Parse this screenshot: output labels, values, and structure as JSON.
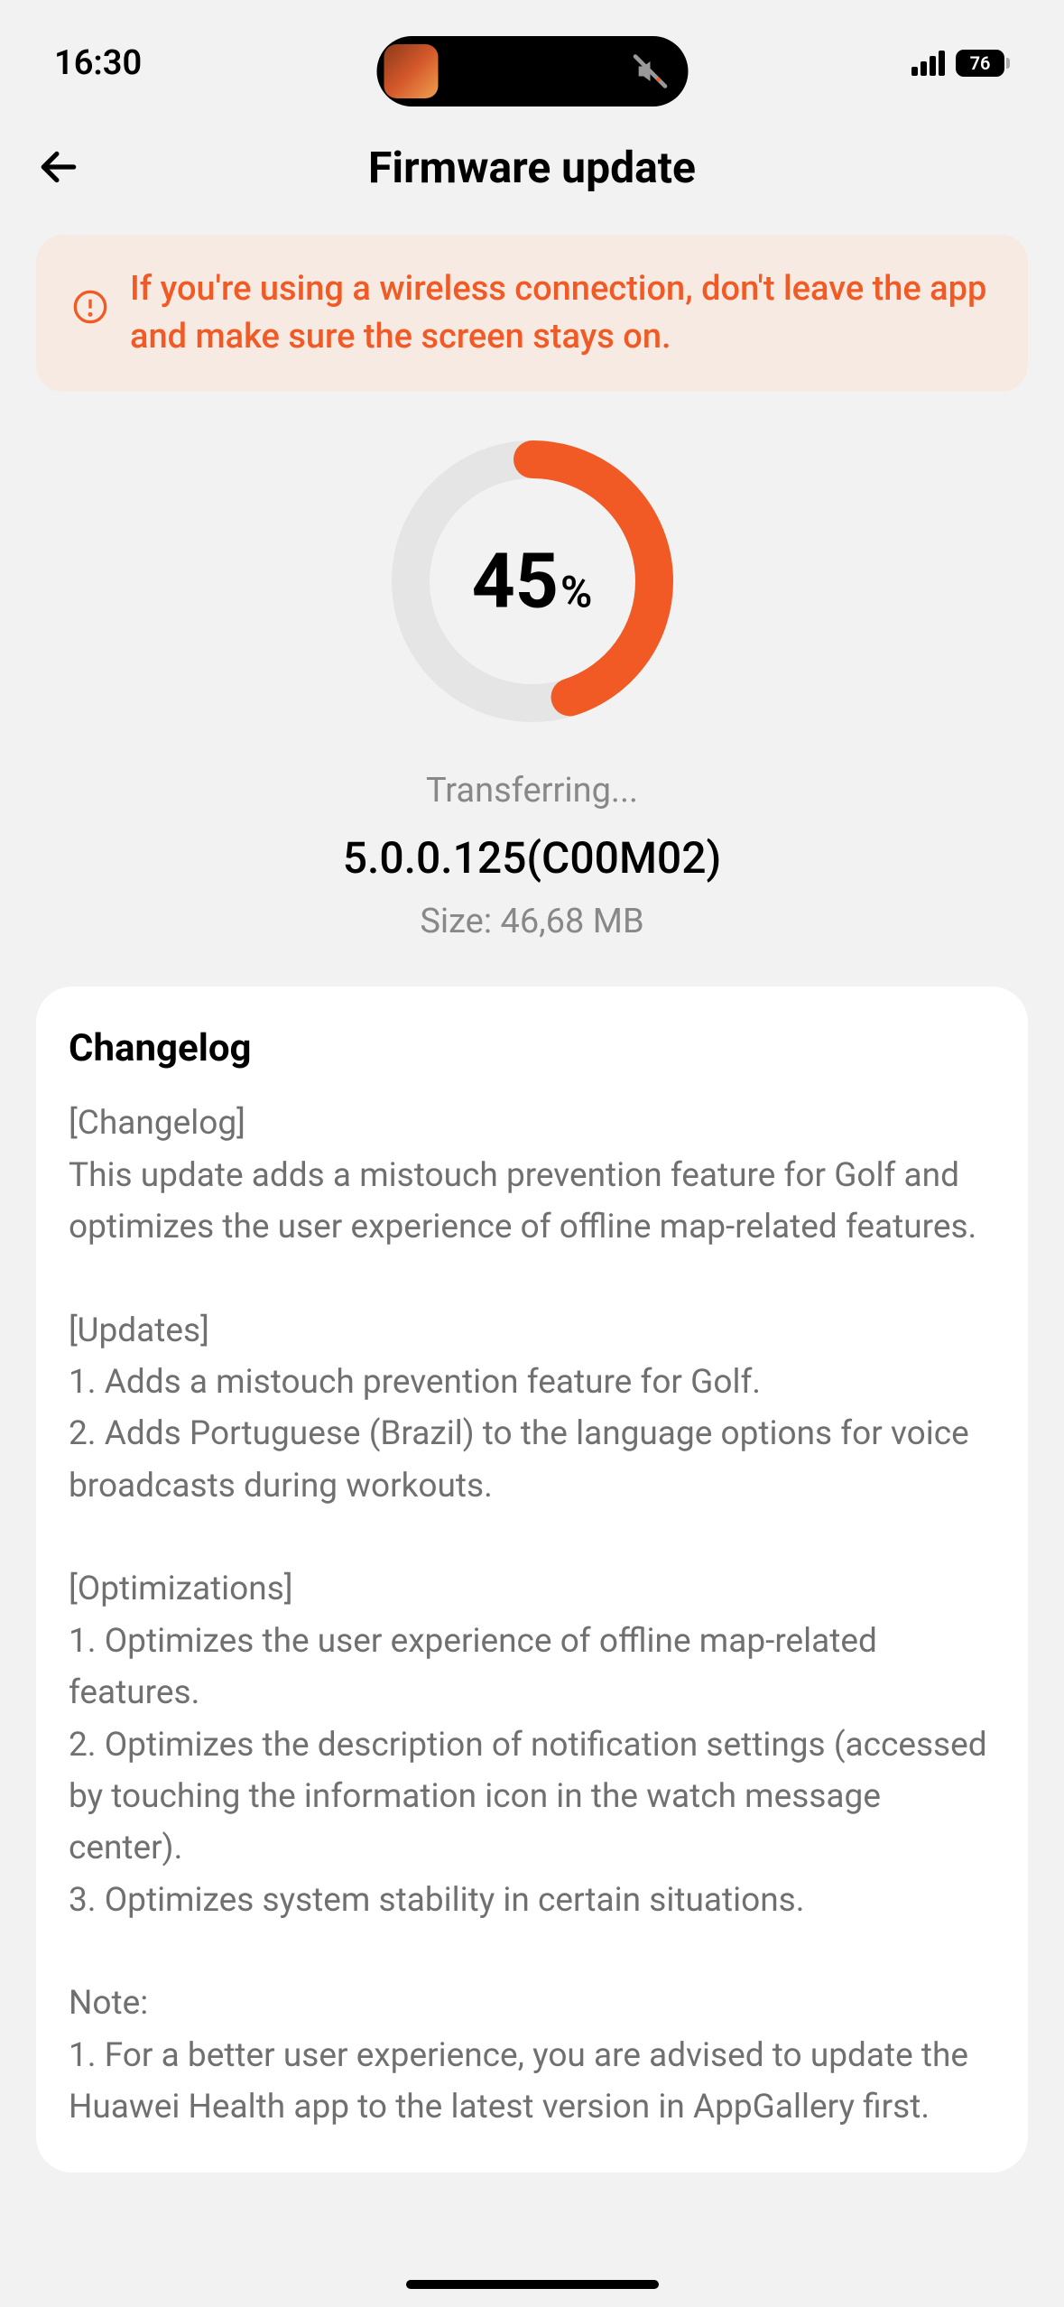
{
  "status_bar": {
    "time": "16:30",
    "battery": "76"
  },
  "header": {
    "title": "Firmware update"
  },
  "warning": {
    "text": "If you're using a wireless connection, don't leave the app and make sure the screen stays on."
  },
  "progress": {
    "value": "45",
    "percent_symbol": "%",
    "status": "Transferring...",
    "version": "5.0.0.125(C00M02)",
    "size": "Size: 46,68 MB"
  },
  "changelog": {
    "title": "Changelog",
    "body": "[Changelog]\nThis update adds a mistouch prevention feature for Golf and optimizes the user experience of offline map-related features.\n\n[Updates]\n1. Adds a mistouch prevention feature for Golf.\n2. Adds Portuguese (Brazil) to the language options for voice broadcasts during workouts.\n\n[Optimizations]\n1. Optimizes the user experience of offline map-related features.\n2. Optimizes the description of notification settings (accessed by touching the information icon in the watch message center).\n3. Optimizes system stability in certain situations.\n\nNote:\n1. For a better user experience, you are advised to update the Huawei Health app to the latest version in AppGallery first."
  }
}
